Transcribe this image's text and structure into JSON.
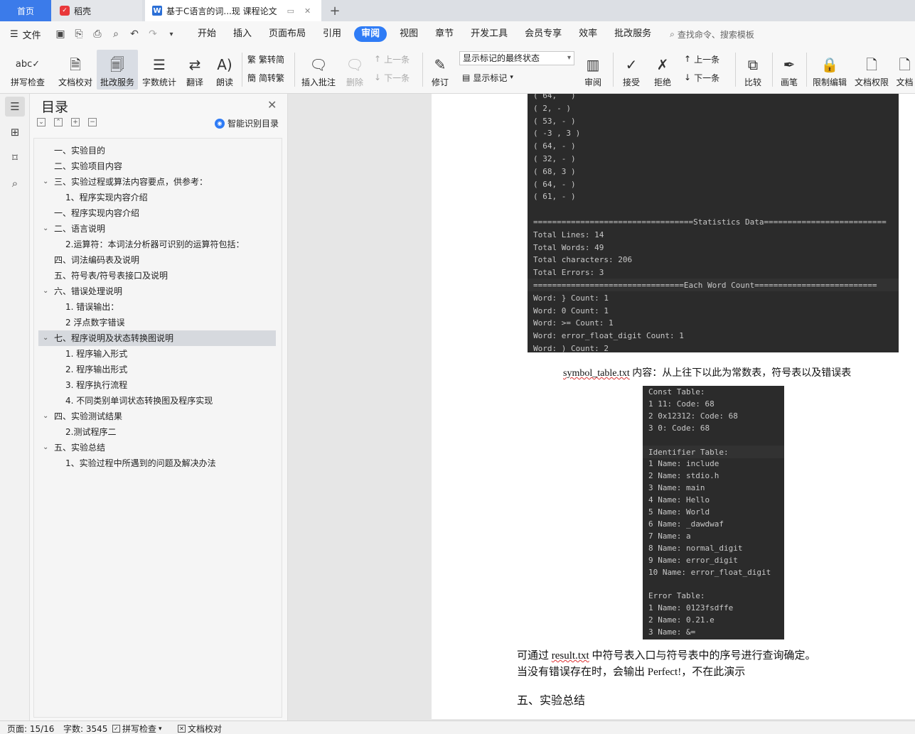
{
  "tabs": {
    "home": "首页",
    "daoke": "稻壳",
    "doc": "基于C语言的词...现  课程论文"
  },
  "menu": {
    "file": "文件",
    "items": [
      "开始",
      "插入",
      "页面布局",
      "引用",
      "审阅",
      "视图",
      "章节",
      "开发工具",
      "会员专享",
      "效率",
      "批改服务"
    ],
    "active": "审阅",
    "search": "查找命令、搜索模板"
  },
  "ribbon": {
    "spellcheck": "拼写检查",
    "doc_proof": "文档校对",
    "correction_service": "批改服务",
    "word_count": "字数统计",
    "translate": "翻译",
    "read_aloud": "朗读",
    "trad_to_simp": "繁转简",
    "simp_to_trad": "简转繁",
    "insert_comment": "插入批注",
    "delete": "删除",
    "prev": "上一条",
    "next": "下一条",
    "track_changes": "修订",
    "markup_state": "显示标记的最终状态",
    "show_markup": "显示标记",
    "review": "审阅",
    "accept": "接受",
    "reject": "拒绝",
    "prev2": "上一条",
    "next2": "下一条",
    "compare": "比较",
    "pen": "画笔",
    "restrict_edit": "限制编辑",
    "doc_permission": "文档权限",
    "doc_more": "文档"
  },
  "toc": {
    "title": "目录",
    "smart": "智能识别目录",
    "items": [
      {
        "text": "一、实验目的",
        "level": 1,
        "chev": false
      },
      {
        "text": "二、实验项目内容",
        "level": 1,
        "chev": false
      },
      {
        "text": "三、实验过程或算法内容要点，供参考：",
        "level": 1,
        "chev": true
      },
      {
        "text": "1、程序实现内容介绍",
        "level": 2,
        "chev": false
      },
      {
        "text": "一、程序实现内容介绍",
        "level": 1,
        "chev": false
      },
      {
        "text": "二、语言说明",
        "level": 1,
        "chev": true
      },
      {
        "text": "2.运算符：本词法分析器可识别的运算符包括：",
        "level": 2,
        "chev": false
      },
      {
        "text": "四、词法编码表及说明",
        "level": 1,
        "chev": false
      },
      {
        "text": "五、符号表/符号表接口及说明",
        "level": 1,
        "chev": false
      },
      {
        "text": "六、错误处理说明",
        "level": 1,
        "chev": true
      },
      {
        "text": "1.   错误输出：",
        "level": 2,
        "chev": false
      },
      {
        "text": "2 浮点数字错误",
        "level": 2,
        "chev": false
      },
      {
        "text": "七、程序说明及状态转换图说明",
        "level": 1,
        "chev": true,
        "selected": true
      },
      {
        "text": "1. 程序输入形式",
        "level": 2,
        "chev": false
      },
      {
        "text": "2. 程序输出形式",
        "level": 2,
        "chev": false
      },
      {
        "text": "3. 程序执行流程",
        "level": 2,
        "chev": false
      },
      {
        "text": "4. 不同类别单词状态转换图及程序实现",
        "level": 2,
        "chev": false
      },
      {
        "text": "四、实验测试结果",
        "level": 1,
        "chev": true
      },
      {
        "text": "2.测试程序二",
        "level": 2,
        "chev": false
      },
      {
        "text": "五、实验总结",
        "level": 1,
        "chev": true
      },
      {
        "text": "1、实验过程中所遇到的问题及解决办法",
        "level": 2,
        "chev": false
      }
    ]
  },
  "console1": [
    "( 64,   )",
    "( 2, - )",
    "( 53, - )",
    "( -3 , 3 )",
    "( 64, - )",
    "( 32, - )",
    "( 68, 3 )",
    "( 64, - )",
    "( 61, - )",
    "",
    "==================================Statistics Data==========================",
    "Total Lines: 14",
    "Total Words: 49",
    "Total characters: 206",
    "Total Errors: 3",
    "================================Each Word Count==========================",
    "Word: } Count: 1",
    "Word: 0 Count: 1",
    "Word: >= Count: 1",
    "Word: error_float_digit Count: 1",
    "Word: ) Count: 2"
  ],
  "caption1": {
    "file": "symbol_table.txt",
    "rest": " 内容：从上往下以此为常数表，符号表以及错误表"
  },
  "console2": [
    "Const Table:",
    "1 11: Code: 68",
    "2 0x12312: Code: 68",
    "3 0: Code: 68",
    "",
    "Identifier Table:",
    "1 Name: include",
    "2 Name: stdio.h",
    "3 Name: main",
    "4 Name: Hello",
    "5 Name: World",
    "6 Name: _dawdwaf",
    "7 Name: a",
    "8 Name: normal_digit",
    "9 Name: error_digit",
    "10 Name: error_float_digit",
    "",
    "Error Table:",
    "1 Name: 0123fsdffe",
    "2 Name: 0.21.e",
    "3 Name: &="
  ],
  "para1": {
    "pre": "可通过 ",
    "file": "result.txt",
    "post": " 中符号表入口与符号表中的序号进行查询确定。"
  },
  "para2": "当没有错误存在时，会输出 Perfect!，不在此演示",
  "heading5": "五、实验总结",
  "status": {
    "page": "页面: 15/16",
    "words": "字数: 3545",
    "spell": "拼写检查",
    "proof": "文档校对"
  }
}
